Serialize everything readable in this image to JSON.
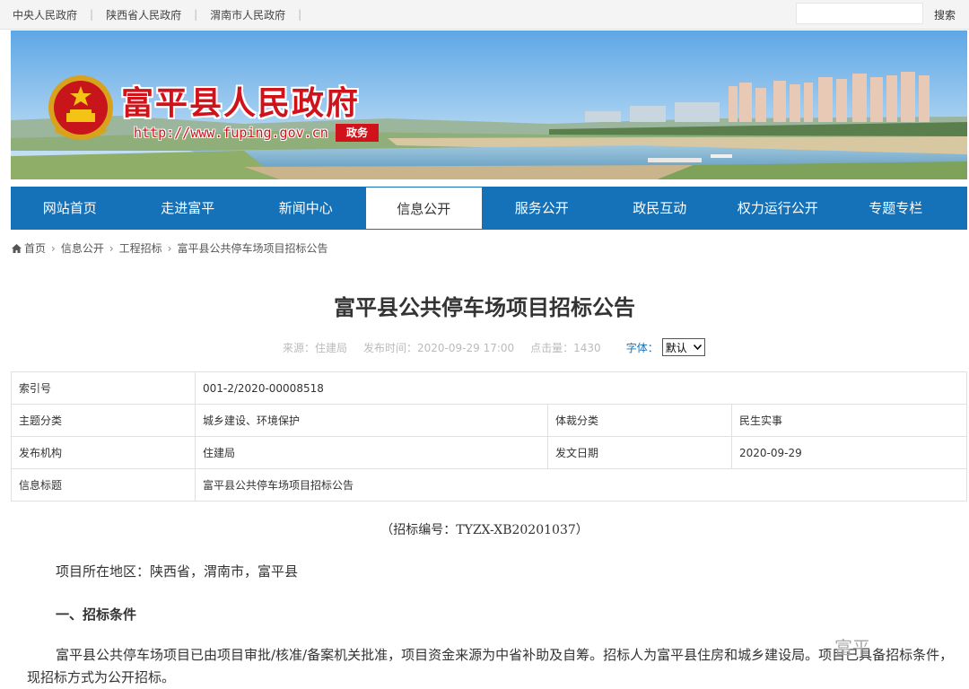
{
  "topbar": {
    "links": [
      "中央人民政府",
      "陕西省人民政府",
      "渭南市人民政府"
    ],
    "search_label": "搜索"
  },
  "banner": {
    "site_name": "富平县人民政府",
    "site_url": "http://www.fuping.gov.cn",
    "badge": "政务"
  },
  "nav": {
    "items": [
      "网站首页",
      "走进富平",
      "新闻中心",
      "信息公开",
      "服务公开",
      "政民互动",
      "权力运行公开",
      "专题专栏"
    ],
    "active": "信息公开"
  },
  "breadcrumb": [
    "首页",
    "信息公开",
    "工程招标",
    "富平县公共停车场项目招标公告"
  ],
  "article": {
    "title": "富平县公共停车场项目招标公告",
    "source": "来源：住建局",
    "date": "发布时间：2020-09-29 17:00",
    "clicks": "点击量：1430",
    "font_label": "字体：",
    "font_value": "默认"
  },
  "info": {
    "index_label": "索引号",
    "index_value": "001-2/2020-00008518",
    "topic_label": "主题分类",
    "topic_value": "城乡建设、环境保护",
    "genre_label": "体裁分类",
    "genre_value": "民生实事",
    "org_label": "发布机构",
    "org_value": "住建局",
    "pubdate_label": "发文日期",
    "pubdate_value": "2020-09-29",
    "title_label": "信息标题",
    "title_value": "富平县公共停车场项目招标公告"
  },
  "body": {
    "doc_number": "（招标编号：TYZX-XB20201037）",
    "location": "项目所在地区：陕西省，渭南市，富平县",
    "section1": "一、招标条件",
    "para1": "富平县公共停车场项目已由项目审批/核准/备案机关批准，项目资金来源为中省补助及自筹。招标人为富平县住房和城乡建设局。项目已具备招标条件，现招标方式为公开招标。",
    "watermark": "富平"
  },
  "colors": {
    "nav": "#1572b8",
    "brand_red": "#d0131a"
  }
}
